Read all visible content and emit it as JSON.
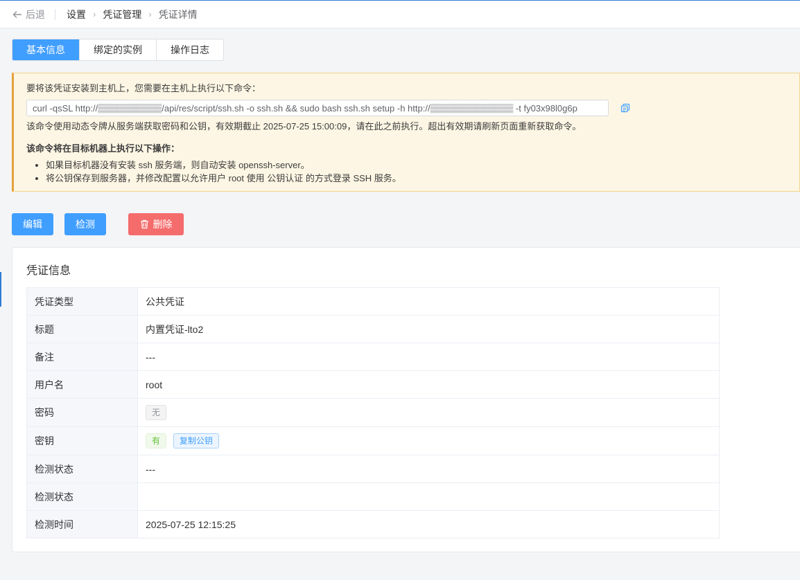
{
  "header": {
    "back_label": "后退",
    "breadcrumb": [
      "设置",
      "凭证管理",
      "凭证详情"
    ]
  },
  "tabs": [
    {
      "label": "基本信息",
      "active": true
    },
    {
      "label": "绑定的实例",
      "active": false
    },
    {
      "label": "操作日志",
      "active": false
    }
  ],
  "notice": {
    "intro": "要将该凭证安装到主机上，您需要在主机上执行以下命令：",
    "command": "curl -qsSL http://▒▒▒▒▒▒▒▒▒▒/api/res/script/ssh.sh -o ssh.sh && sudo bash ssh.sh setup -h http://▒▒▒▒▒▒▒▒▒▒▒▒▒ -t fy03x98l0g6p",
    "desc": "该命令使用动态令牌从服务端获取密码和公钥，有效期截止 2025-07-25 15:00:09，请在此之前执行。超出有效期请刷新页面重新获取命令。",
    "ops_title": "该命令将在目标机器上执行以下操作：",
    "ops": [
      "如果目标机器没有安装 ssh 服务端，则自动安装 openssh-server。",
      "将公钥保存到服务器，并修改配置以允许用户 root 使用 公钥认证 的方式登录 SSH 服务。"
    ]
  },
  "actions": {
    "edit": "编辑",
    "check": "检测",
    "delete": "删除"
  },
  "card": {
    "title": "凭证信息",
    "rows": [
      {
        "label": "凭证类型",
        "value": "公共凭证"
      },
      {
        "label": "标题",
        "value": "内置凭证-lto2"
      },
      {
        "label": "备注",
        "value": "---"
      },
      {
        "label": "用户名",
        "value": "root"
      },
      {
        "label": "密码",
        "tag": "无"
      },
      {
        "label": "密钥",
        "tag": "有",
        "copy": "复制公钥"
      },
      {
        "label": "检测状态",
        "value": "---"
      },
      {
        "label": "检测状态",
        "value": ""
      },
      {
        "label": "检测时间",
        "value": "2025-07-25 12:15:25"
      }
    ]
  },
  "colors": {
    "primary": "#409eff",
    "danger": "#f56c6c",
    "warning_bg": "#fdf6e4",
    "warning_border": "#e6a23c",
    "success": "#67c23a"
  }
}
